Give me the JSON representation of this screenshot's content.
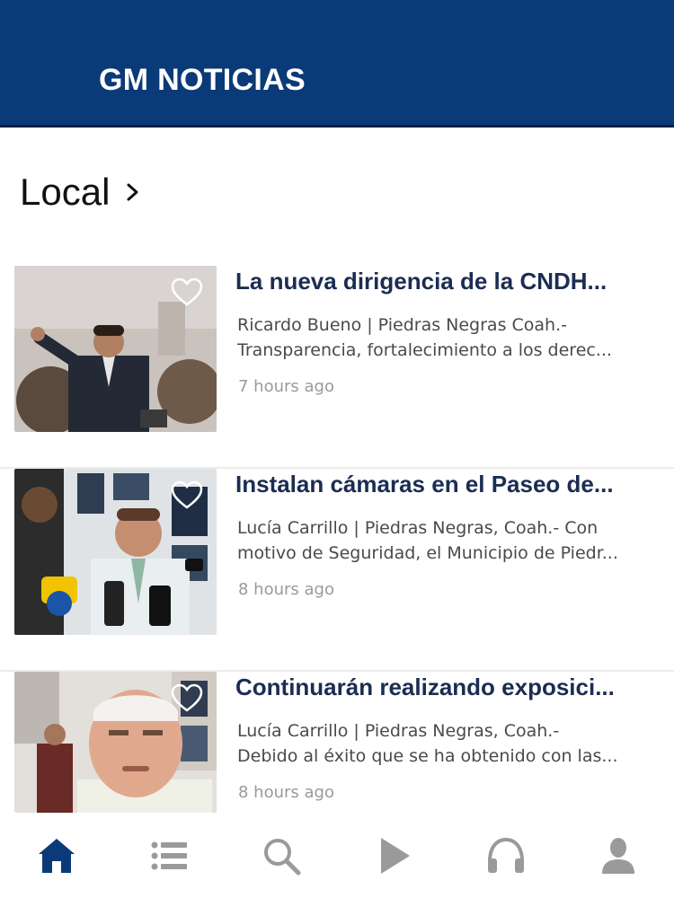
{
  "app": {
    "title": "GM NOTICIAS",
    "colors": {
      "header": "#0b3a78",
      "title_text": "#1b2d52",
      "tab_active": "#0b3a78",
      "tab_inactive": "#9a9a9a"
    }
  },
  "section": {
    "title": "Local"
  },
  "articles": [
    {
      "title": "La nueva dirigencia de la CNDH...",
      "excerpt_line1": "Ricardo Bueno | Piedras Negras Coah.-",
      "excerpt_line2": "Transparencia, fortalecimiento a los derec...",
      "time": "7 hours ago"
    },
    {
      "title": "Instalan cámaras en el Paseo de...",
      "excerpt_line1": "Lucía Carrillo | Piedras Negras, Coah.- Con",
      "excerpt_line2": "motivo de Seguridad, el Municipio de Piedr...",
      "time": "8 hours ago"
    },
    {
      "title": "Continuarán realizando exposici...",
      "excerpt_line1": "Lucía Carrillo | Piedras Negras, Coah.-",
      "excerpt_line2": " Debido al éxito que se ha obtenido con las...",
      "time": "8 hours ago"
    }
  ],
  "tabbar": {
    "tabs": [
      {
        "icon": "home-icon",
        "active": true
      },
      {
        "icon": "list-icon",
        "active": false
      },
      {
        "icon": "search-icon",
        "active": false
      },
      {
        "icon": "play-icon",
        "active": false
      },
      {
        "icon": "headphones-icon",
        "active": false
      },
      {
        "icon": "profile-icon",
        "active": false
      }
    ]
  }
}
